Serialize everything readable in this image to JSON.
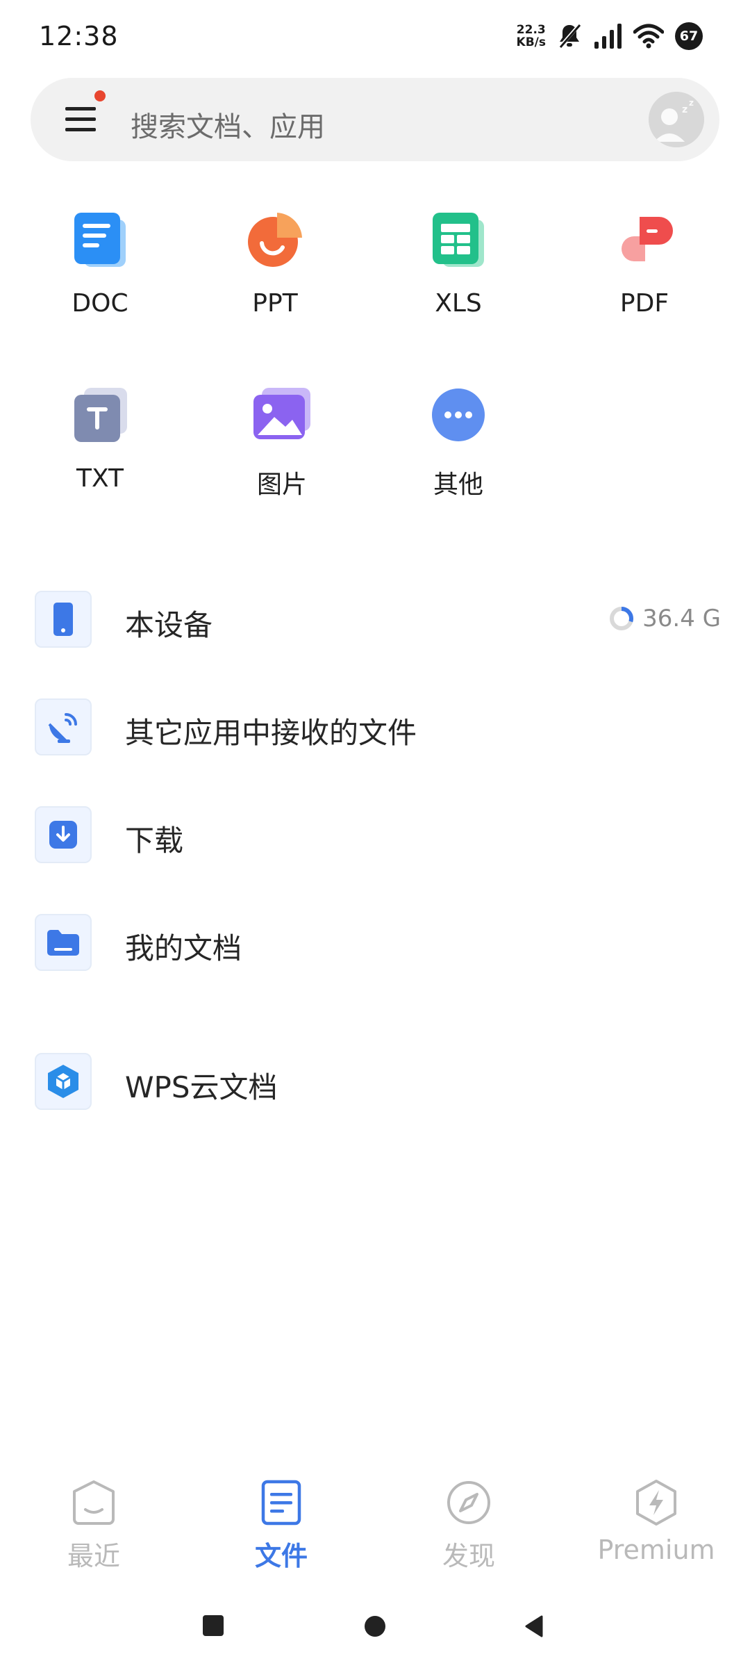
{
  "status_bar": {
    "time": "12:38",
    "net_speed_value": "22.3",
    "net_speed_unit": "KB/s",
    "battery": "67"
  },
  "search": {
    "placeholder": "搜索文档、应用"
  },
  "file_types": [
    {
      "label": "DOC",
      "icon": "doc-icon",
      "color": "#2b8ff5"
    },
    {
      "label": "PPT",
      "icon": "ppt-icon",
      "color": "#f26b3a"
    },
    {
      "label": "XLS",
      "icon": "xls-icon",
      "color": "#22c08a"
    },
    {
      "label": "PDF",
      "icon": "pdf-icon",
      "color": "#ef4d4d"
    },
    {
      "label": "TXT",
      "icon": "txt-icon",
      "color": "#7f8bb0"
    },
    {
      "label": "图片",
      "icon": "image-icon",
      "color": "#8b63f0"
    },
    {
      "label": "其他",
      "icon": "more-icon",
      "color": "#5f8ff0"
    }
  ],
  "locations": [
    {
      "label": "本设备",
      "icon": "phone-icon",
      "meta": "36.4 G",
      "usage_fraction": 0.3
    },
    {
      "label": "其它应用中接收的文件",
      "icon": "satellite-icon"
    },
    {
      "label": "下载",
      "icon": "download-icon"
    },
    {
      "label": "我的文档",
      "icon": "folder-icon"
    },
    {
      "label": "WPS云文档",
      "icon": "cloud-cube-icon"
    }
  ],
  "tabs": [
    {
      "label": "最近",
      "icon": "recent-icon",
      "active": false
    },
    {
      "label": "文件",
      "icon": "file-icon",
      "active": true
    },
    {
      "label": "发现",
      "icon": "compass-icon",
      "active": false
    },
    {
      "label": "Premium",
      "icon": "premium-bolt-icon",
      "active": false
    }
  ],
  "colors": {
    "accent": "#3d78e6",
    "inactive_tab": "#b9b9b9",
    "notification_dot": "#e8462f"
  }
}
